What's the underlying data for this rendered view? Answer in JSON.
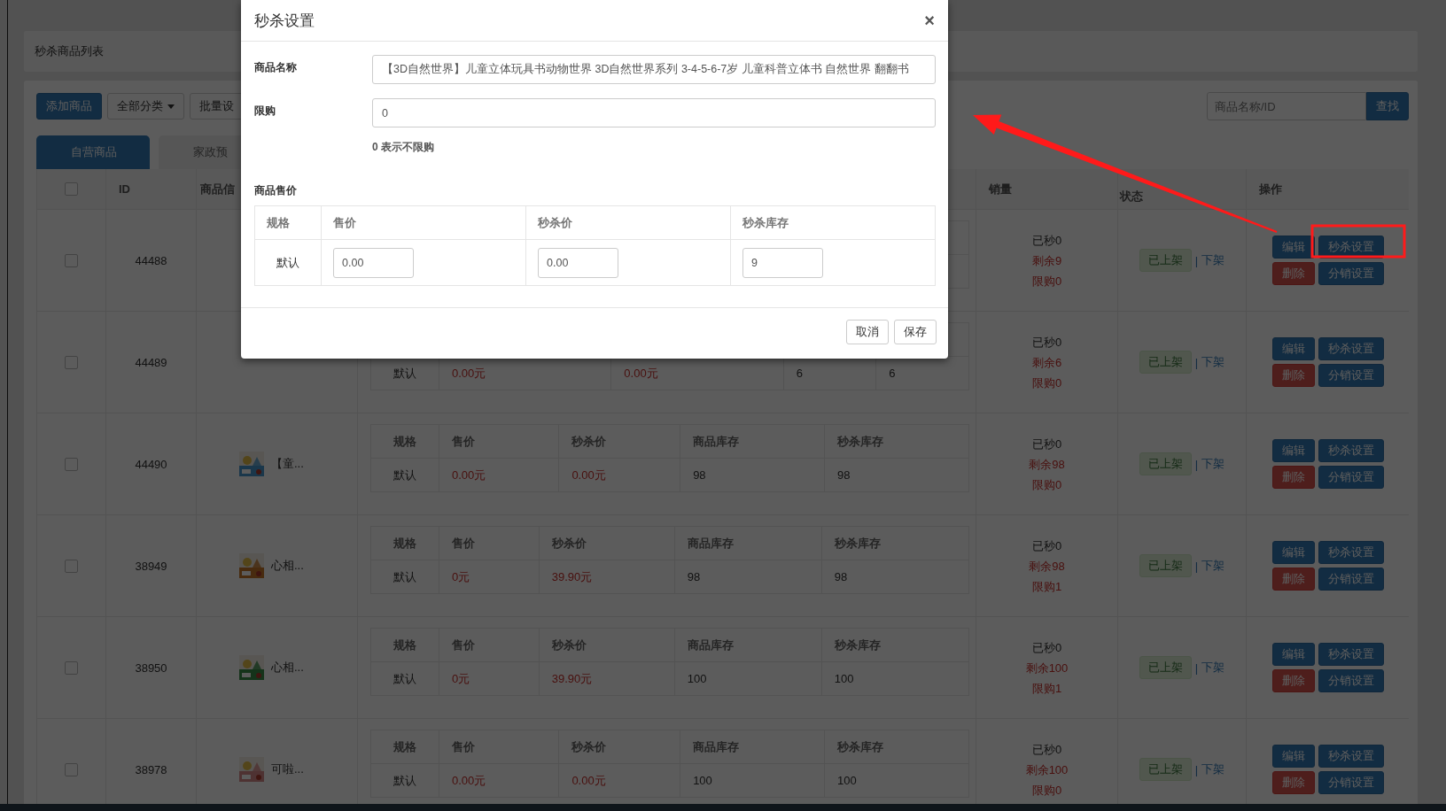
{
  "page_title": "秒杀商品列表",
  "toolbar": {
    "add_button": "添加商品",
    "category_dropdown": "全部分类",
    "batch_button": "批量设",
    "search": {
      "placeholder": "商品名称/ID"
    },
    "search_button": "查找"
  },
  "tabs": [
    {
      "label": "自营商品",
      "selected": true
    },
    {
      "label": "家政预",
      "selected": false
    }
  ],
  "table": {
    "header": {
      "checked": false,
      "id": "ID",
      "product": "商品信",
      "sales": "销量",
      "status": "状态",
      "actions": "操作"
    },
    "rows": [
      {
        "checked": false,
        "id": "44488",
        "sales": {
          "sold": "已秒0",
          "remaining": "剩余9",
          "limit": "限购0"
        },
        "status": {
          "badge": "已上架",
          "separator": "|",
          "link": "下架"
        },
        "actions": [
          {
            "label": "编辑",
            "kind": "primary"
          },
          {
            "label": "秒杀设置",
            "kind": "primary"
          },
          {
            "label": "删除",
            "kind": "danger"
          },
          {
            "label": "分销设置",
            "kind": "primary"
          }
        ]
      },
      {
        "checked": false,
        "id": "44489",
        "specs": {
          "rows": [
            [
              "默认",
              "0.00元",
              "0.00元",
              "6",
              "6"
            ]
          ]
        },
        "sales": {
          "sold": "已秒0",
          "remaining": "剩余6",
          "limit": "限购0"
        },
        "status": {
          "badge": "已上架",
          "separator": "|",
          "link": "下架"
        },
        "actions": [
          {
            "label": "编辑",
            "kind": "primary"
          },
          {
            "label": "秒杀设置",
            "kind": "primary"
          },
          {
            "label": "删除",
            "kind": "danger"
          },
          {
            "label": "分销设置",
            "kind": "primary"
          }
        ]
      },
      {
        "checked": false,
        "id": "44490",
        "product": {
          "name": "【童..."
        },
        "specs": {
          "header": [
            "规格",
            "售价",
            "秒杀价",
            "商品库存",
            "秒杀库存"
          ],
          "rows": [
            [
              "默认",
              "0.00元",
              "0.00元",
              "98",
              "98"
            ]
          ]
        },
        "sales": {
          "sold": "已秒0",
          "remaining": "剩余98",
          "limit": "限购0"
        },
        "status": {
          "badge": "已上架",
          "separator": "|",
          "link": "下架"
        },
        "actions": [
          {
            "label": "编辑",
            "kind": "primary"
          },
          {
            "label": "秒杀设置",
            "kind": "primary"
          },
          {
            "label": "删除",
            "kind": "danger"
          },
          {
            "label": "分销设置",
            "kind": "primary"
          }
        ]
      },
      {
        "checked": false,
        "id": "38949",
        "product": {
          "name": "心相..."
        },
        "specs": {
          "header": [
            "规格",
            "售价",
            "秒杀价",
            "商品库存",
            "秒杀库存"
          ],
          "rows": [
            [
              "默认",
              "0元",
              "39.90元",
              "98",
              "98"
            ]
          ]
        },
        "sales": {
          "sold": "已秒0",
          "remaining": "剩余98",
          "limit": "限购1"
        },
        "status": {
          "badge": "已上架",
          "separator": "|",
          "link": "下架"
        },
        "actions": [
          {
            "label": "编辑",
            "kind": "primary"
          },
          {
            "label": "秒杀设置",
            "kind": "primary"
          },
          {
            "label": "删除",
            "kind": "danger"
          },
          {
            "label": "分销设置",
            "kind": "primary"
          }
        ]
      },
      {
        "checked": false,
        "id": "38950",
        "product": {
          "name": "心相..."
        },
        "specs": {
          "header": [
            "规格",
            "售价",
            "秒杀价",
            "商品库存",
            "秒杀库存"
          ],
          "rows": [
            [
              "默认",
              "0元",
              "39.90元",
              "100",
              "100"
            ]
          ]
        },
        "sales": {
          "sold": "已秒0",
          "remaining": "剩余100",
          "limit": "限购1"
        },
        "status": {
          "badge": "已上架",
          "separator": "|",
          "link": "下架"
        },
        "actions": [
          {
            "label": "编辑",
            "kind": "primary"
          },
          {
            "label": "秒杀设置",
            "kind": "primary"
          },
          {
            "label": "删除",
            "kind": "danger"
          },
          {
            "label": "分销设置",
            "kind": "primary"
          }
        ]
      },
      {
        "checked": false,
        "id": "38978",
        "product": {
          "name": "可啦..."
        },
        "specs": {
          "header": [
            "规格",
            "售价",
            "秒杀价",
            "商品库存",
            "秒杀库存"
          ],
          "rows": [
            [
              "默认",
              "0.00元",
              "0.00元",
              "100",
              "100"
            ]
          ]
        },
        "sales": {
          "sold": "已秒0",
          "remaining": "剩余100",
          "limit": "限购0"
        },
        "status": {
          "badge": "已上架",
          "separator": "|",
          "link": "下架"
        },
        "actions": [
          {
            "label": "编辑",
            "kind": "primary"
          },
          {
            "label": "秒杀设置",
            "kind": "primary"
          },
          {
            "label": "删除",
            "kind": "danger"
          },
          {
            "label": "分销设置",
            "kind": "primary"
          }
        ]
      }
    ]
  },
  "dialog": {
    "title": "秒杀设置",
    "close": "×",
    "fields": [
      {
        "label": "商品名称",
        "value": "【3D自然世界】儿童立体玩具书动物世界 3D自然世界系列 3-4-5-6-7岁 儿童科普立体书 自然世界 翻翻书"
      },
      {
        "label": "限购",
        "value": "0",
        "help": "0 表示不限购"
      }
    ],
    "price_section": "商品售价",
    "price_table": {
      "columns": [
        "规格",
        "售价",
        "秒杀价",
        "秒杀库存"
      ],
      "rows": [
        {
          "spec": "默认",
          "values": [
            "0.00",
            "0.00",
            "9"
          ]
        }
      ]
    },
    "buttons": [
      {
        "label": "取消"
      },
      {
        "label": "保存"
      }
    ]
  }
}
